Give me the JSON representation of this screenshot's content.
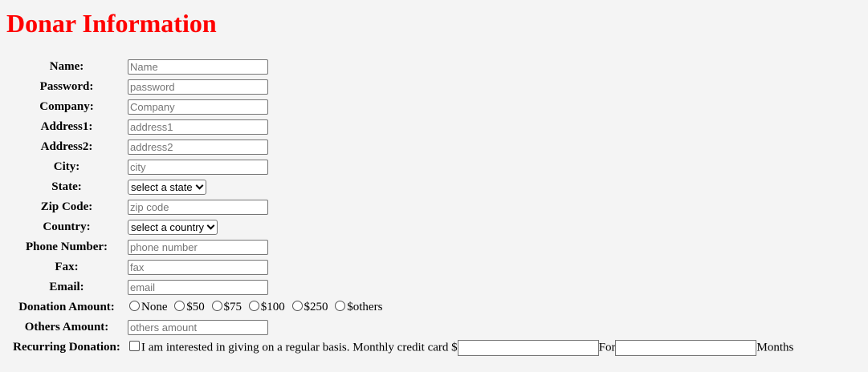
{
  "title": "Donar Information",
  "fields": [
    {
      "label": "Name:",
      "placeholder": "Name"
    },
    {
      "label": "Password:",
      "placeholder": "password"
    },
    {
      "label": "Company:",
      "placeholder": "Company"
    },
    {
      "label": "Address1:",
      "placeholder": "address1"
    },
    {
      "label": "Address2:",
      "placeholder": "address2"
    },
    {
      "label": "City:",
      "placeholder": "city"
    }
  ],
  "state": {
    "label": "State:",
    "selected": "select a state"
  },
  "zip": {
    "label": "Zip Code:",
    "placeholder": "zip code"
  },
  "country": {
    "label": "Country:",
    "selected": "select a country"
  },
  "contact": [
    {
      "label": "Phone Number:",
      "placeholder": "phone number"
    },
    {
      "label": "Fax:",
      "placeholder": "fax"
    },
    {
      "label": "Email:",
      "placeholder": "email"
    }
  ],
  "donation": {
    "label": "Donation Amount:",
    "options": [
      "None",
      "$50",
      "$75",
      "$100",
      "$250",
      "$others"
    ]
  },
  "others": {
    "label": "Others Amount:",
    "placeholder": "others amount"
  },
  "recurring": {
    "label": "Recurring Donation:",
    "text": "I am interested in giving on a regular basis. Monthly credit card $",
    "for_label": "For",
    "months_label": "Months"
  }
}
